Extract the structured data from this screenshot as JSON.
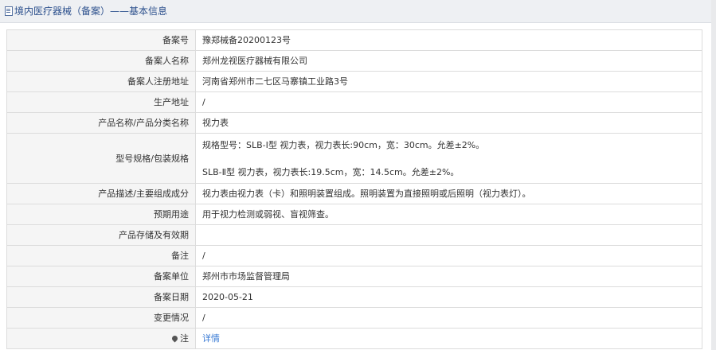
{
  "header": {
    "title": "境内医疗器械（备案）——基本信息"
  },
  "rows": [
    {
      "label": "备案号",
      "value": "豫郑械备20200123号"
    },
    {
      "label": "备案人名称",
      "value": "郑州龙视医疗器械有限公司"
    },
    {
      "label": "备案人注册地址",
      "value": "河南省郑州市二七区马寨镇工业路3号"
    },
    {
      "label": "生产地址",
      "value": "/"
    },
    {
      "label": "产品名称/产品分类名称",
      "value": "视力表"
    },
    {
      "label": "型号规格/包装规格",
      "value_line1": "规格型号：SLB-Ⅰ型 视力表，视力表长:90cm，宽：30cm。允差±2%。",
      "value_line2": "SLB-Ⅱ型 视力表，视力表长:19.5cm，宽：14.5cm。允差±2%。"
    },
    {
      "label": "产品描述/主要组成成分",
      "value": "视力表由视力表（卡）和照明装置组成。照明装置为直接照明或后照明（视力表灯）。"
    },
    {
      "label": "预期用途",
      "value": "用于视力检测或弱视、盲视筛查。"
    },
    {
      "label": "产品存储及有效期",
      "value": ""
    },
    {
      "label": "备注",
      "value": "/"
    },
    {
      "label": "备案单位",
      "value": "郑州市市场监督管理局"
    },
    {
      "label": "备案日期",
      "value": "2020-05-21"
    },
    {
      "label": "变更情况",
      "value": "/"
    },
    {
      "label": "注",
      "link": "详情"
    }
  ]
}
